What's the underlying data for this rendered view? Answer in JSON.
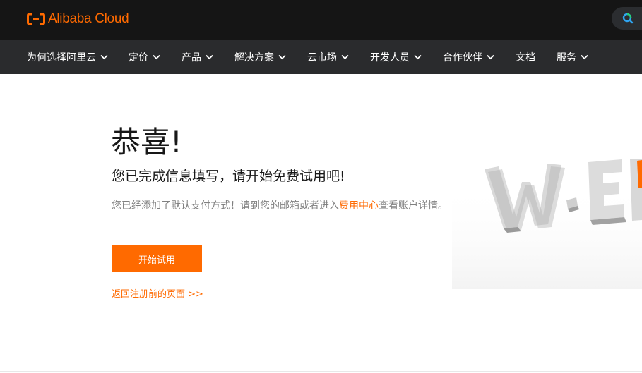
{
  "header": {
    "logo_text": "Alibaba Cloud",
    "brand_color": "#ff6a00",
    "search_icon": "search-icon"
  },
  "nav": {
    "items": [
      {
        "label": "为何选择阿里云",
        "has_dropdown": true
      },
      {
        "label": "定价",
        "has_dropdown": true
      },
      {
        "label": "产品",
        "has_dropdown": true
      },
      {
        "label": "解决方案",
        "has_dropdown": true
      },
      {
        "label": "云市场",
        "has_dropdown": true
      },
      {
        "label": "开发人员",
        "has_dropdown": true
      },
      {
        "label": "合作伙伴",
        "has_dropdown": true
      },
      {
        "label": "文档",
        "has_dropdown": false
      },
      {
        "label": "服务",
        "has_dropdown": true
      }
    ]
  },
  "main": {
    "headline": "恭喜!",
    "subheadline": "您已完成信息填写，请开始免费试用吧!",
    "description_before": "您已经添加了默认支付方式！请到您的邮箱或者进入",
    "description_link": "费用中心",
    "description_after": "查看账户详情。",
    "primary_button": "开始试用",
    "back_link": "返回注册前的页面 >>"
  }
}
